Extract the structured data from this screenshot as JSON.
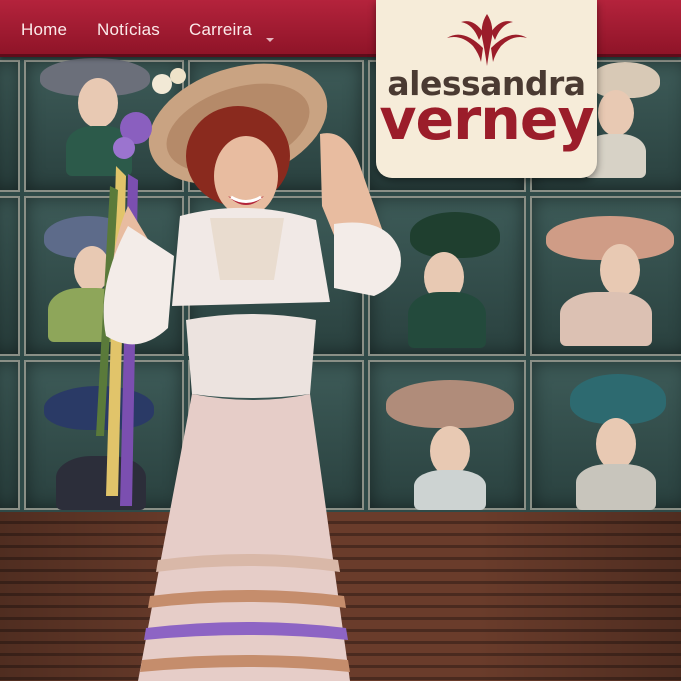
{
  "nav": {
    "items": [
      {
        "label": "Home"
      },
      {
        "label": "Notícias"
      },
      {
        "label": "Carreira"
      }
    ],
    "has_more_dropdown": true
  },
  "logo": {
    "line1": "alessandra",
    "line2": "verney",
    "ornament_icon": "fleur-de-lis-icon"
  },
  "hero": {
    "image_icon": "performer-photo"
  },
  "colors": {
    "nav_bar": "#a51c34",
    "logo_card": "#f6ecd9",
    "logo_text_dark": "#4a3a32",
    "logo_text_accent": "#9b1d2a",
    "nav_text": "#fbeaea"
  }
}
